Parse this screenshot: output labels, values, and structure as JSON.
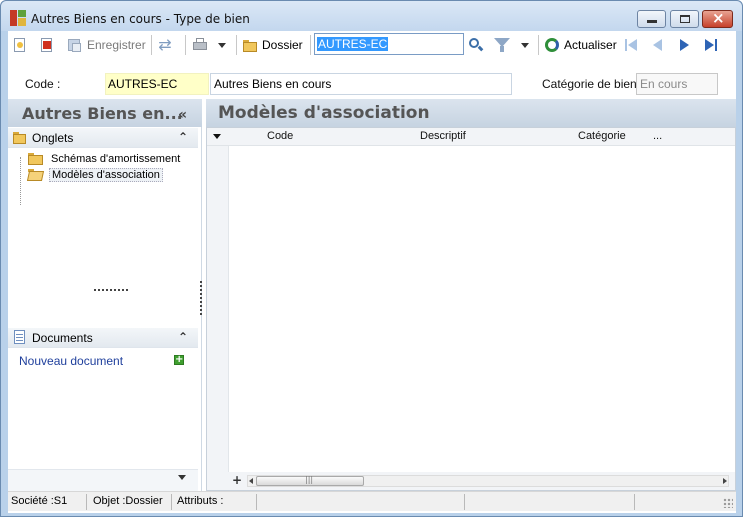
{
  "window": {
    "title": "Autres Biens en cours -  Type de bien"
  },
  "toolbar": {
    "save_label": "Enregistrer",
    "folder_label": "Dossier",
    "search_value": "AUTRES-EC",
    "refresh_label": "Actualiser"
  },
  "header": {
    "code_label": "Code :",
    "code_value": "AUTRES-EC",
    "description_value": "Autres Biens en cours",
    "category_label": "Catégorie de bien :",
    "category_value": "En cours"
  },
  "left_panel": {
    "title": "Autres Biens en...",
    "collapse_glyph": "«",
    "tabs_section": {
      "title": "Onglets",
      "chevron": "⌃",
      "items": [
        {
          "label": "Schémas d'amortissement"
        },
        {
          "label": "Modèles d'association"
        }
      ]
    },
    "docs_section": {
      "title": "Documents",
      "chevron": "⌃",
      "new_document": "Nouveau document"
    }
  },
  "right_panel": {
    "title": "Modèles d'association",
    "grid": {
      "columns": [
        "Code",
        "Descriptif",
        "Catégorie",
        "..."
      ],
      "rows": [],
      "add_glyph": "+"
    }
  },
  "statusbar": {
    "company": "Société :S1",
    "object": "Objet :Dossier",
    "attributes": "Attributs :"
  },
  "colors": {
    "code_field_bg": "#ffffc8",
    "selection_blue": "#3399ff",
    "link_blue": "#1f3f9c",
    "close_red": "#c7412b"
  }
}
